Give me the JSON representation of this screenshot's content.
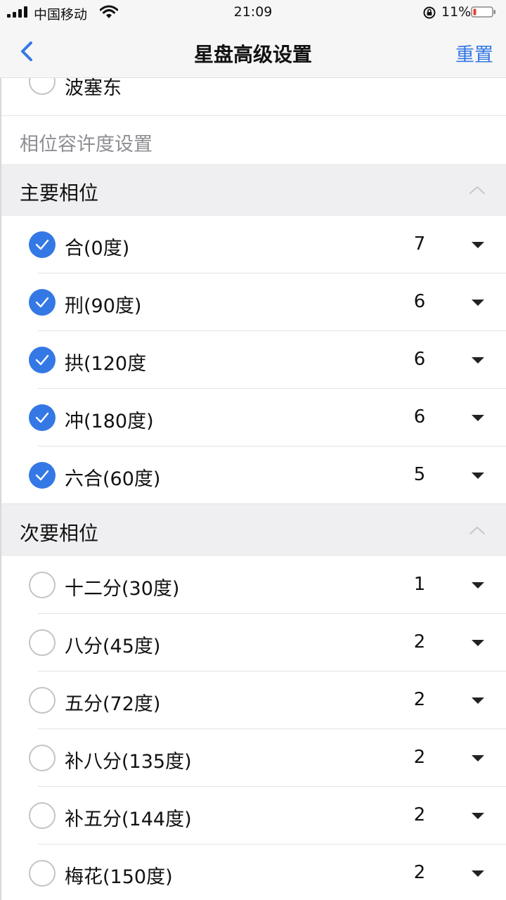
{
  "status_bar": {
    "carrier": "中国移动",
    "time": "21:09",
    "battery_percent": "11%"
  },
  "nav": {
    "title": "星盘高级设置",
    "reset_label": "重置",
    "back_icon": "chevron-left-icon"
  },
  "top_item": {
    "label": "波塞东",
    "checked": false
  },
  "caption": "相位容许度设置",
  "groups": [
    {
      "title": "主要相位",
      "expanded": true,
      "items": [
        {
          "label": "合(0度)",
          "value": "7",
          "checked": true
        },
        {
          "label": "刑(90度)",
          "value": "6",
          "checked": true
        },
        {
          "label": "拱(120度",
          "value": "6",
          "checked": true
        },
        {
          "label": "冲(180度)",
          "value": "6",
          "checked": true
        },
        {
          "label": "六合(60度)",
          "value": "5",
          "checked": true
        }
      ]
    },
    {
      "title": "次要相位",
      "expanded": true,
      "items": [
        {
          "label": "十二分(30度)",
          "value": "1",
          "checked": false
        },
        {
          "label": "八分(45度)",
          "value": "2",
          "checked": false
        },
        {
          "label": "五分(72度)",
          "value": "2",
          "checked": false
        },
        {
          "label": "补八分(135度)",
          "value": "2",
          "checked": false
        },
        {
          "label": "补五分(144度)",
          "value": "2",
          "checked": false
        },
        {
          "label": "梅花(150度)",
          "value": "2",
          "checked": false
        }
      ]
    }
  ],
  "colors": {
    "accent": "#3478e5",
    "header_bg": "#efeff1",
    "caption_text": "#8e8e93"
  }
}
